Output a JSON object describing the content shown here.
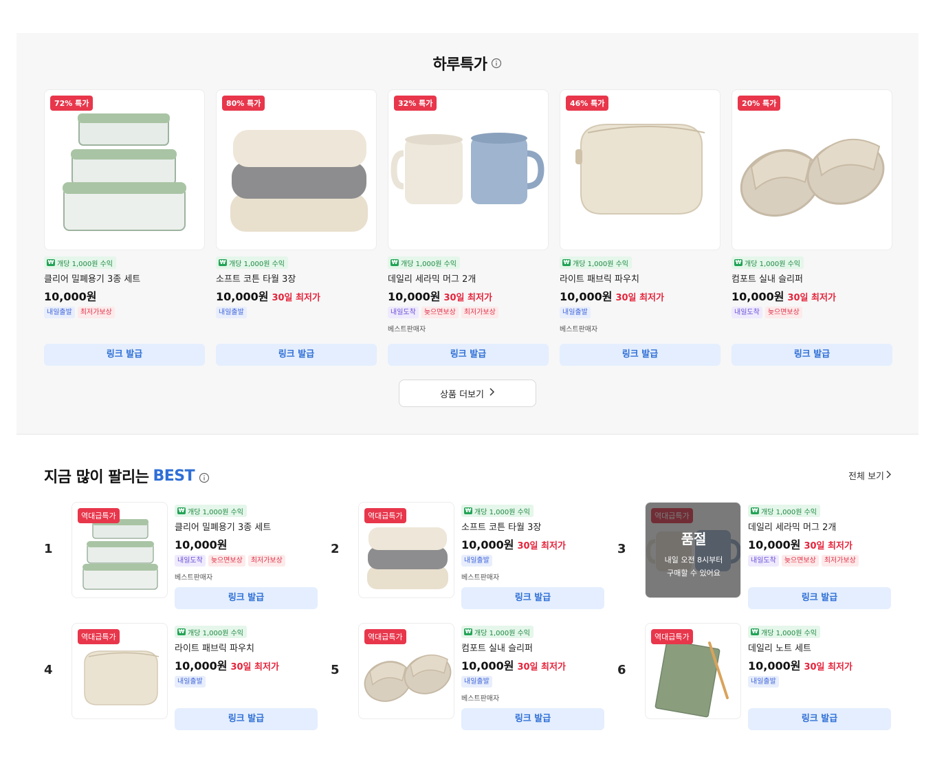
{
  "deal": {
    "title": "하루특가",
    "more_label": "상품 더보기",
    "link_label": "링크 발급",
    "earn_label": "개당 1,000원 수익",
    "won_icon": "₩",
    "items": [
      {
        "discount": "72% 특가",
        "name": "클리어 밀폐용기 3종 세트",
        "price": "10,000원",
        "lowest": "",
        "tags": [
          "내일출발",
          "최저가보상"
        ],
        "seller": "",
        "icon": "glass-container-icon"
      },
      {
        "discount": "80% 특가",
        "name": "소프트 코튼 타월 3장",
        "price": "10,000원",
        "lowest": "30일 최저가",
        "tags": [
          "내일출발"
        ],
        "seller": "",
        "icon": "towel-icon"
      },
      {
        "discount": "32% 특가",
        "name": "데일리 세라믹 머그 2개",
        "price": "10,000원",
        "lowest": "30일 최저가",
        "tags": [
          "내일도착",
          "늦으면보상",
          "최저가보상"
        ],
        "seller": "베스트판매자",
        "icon": "mug-icon"
      },
      {
        "discount": "46% 특가",
        "name": "라이트 패브릭 파우치",
        "price": "10,000원",
        "lowest": "30일 최저가",
        "tags": [
          "내일출발"
        ],
        "seller": "베스트판매자",
        "icon": "pouch-icon"
      },
      {
        "discount": "20% 특가",
        "name": "컴포트 실내 슬리퍼",
        "price": "10,000원",
        "lowest": "30일 최저가",
        "tags": [
          "내일도착",
          "늦으면보상"
        ],
        "seller": "",
        "icon": "slipper-icon"
      }
    ]
  },
  "best": {
    "title_prefix": "지금 많이 팔리는",
    "title_accent": "BEST",
    "view_all_label": "전체 보기",
    "badge": "역대급특가",
    "link_label": "링크 발급",
    "earn_label": "개당 1,000원 수익",
    "soldout_title": "품절",
    "soldout_line1": "내일 오전 8시부터",
    "soldout_line2": "구매할 수 있어요",
    "items": [
      {
        "rank": "1",
        "name": "클리어 밀폐용기 3종 세트",
        "price": "10,000원",
        "lowest": "",
        "tags": [
          "내일도착",
          "늦으면보상",
          "최저가보상"
        ],
        "seller": "베스트판매자",
        "soldout": false,
        "icon": "glass-container-icon"
      },
      {
        "rank": "2",
        "name": "소프트 코튼 타월 3장",
        "price": "10,000원",
        "lowest": "30일 최저가",
        "tags": [
          "내일출발"
        ],
        "seller": "베스트판매자",
        "soldout": false,
        "icon": "towel-icon"
      },
      {
        "rank": "3",
        "name": "데일리 세라믹 머그 2개",
        "price": "10,000원",
        "lowest": "30일 최저가",
        "tags": [
          "내일도착",
          "늦으면보상",
          "최저가보상"
        ],
        "seller": "",
        "soldout": true,
        "icon": "mug-icon"
      },
      {
        "rank": "4",
        "name": "라이트 패브릭 파우치",
        "price": "10,000원",
        "lowest": "30일 최저가",
        "tags": [
          "내일출발"
        ],
        "seller": "",
        "soldout": false,
        "icon": "pouch-icon"
      },
      {
        "rank": "5",
        "name": "컴포트 실내 슬리퍼",
        "price": "10,000원",
        "lowest": "30일 최저가",
        "tags": [
          "내일출발"
        ],
        "seller": "베스트판매자",
        "soldout": false,
        "icon": "slipper-icon"
      },
      {
        "rank": "6",
        "name": "데일리 노트 세트",
        "price": "10,000원",
        "lowest": "30일 최저가",
        "tags": [
          "내일출발"
        ],
        "seller": "",
        "soldout": false,
        "icon": "notebook-icon"
      }
    ]
  },
  "colors": {
    "accent": "#2f6fd6",
    "discount": "#e8364b",
    "lowest": "#e5243b",
    "earn_bg": "#e5f6ea"
  }
}
